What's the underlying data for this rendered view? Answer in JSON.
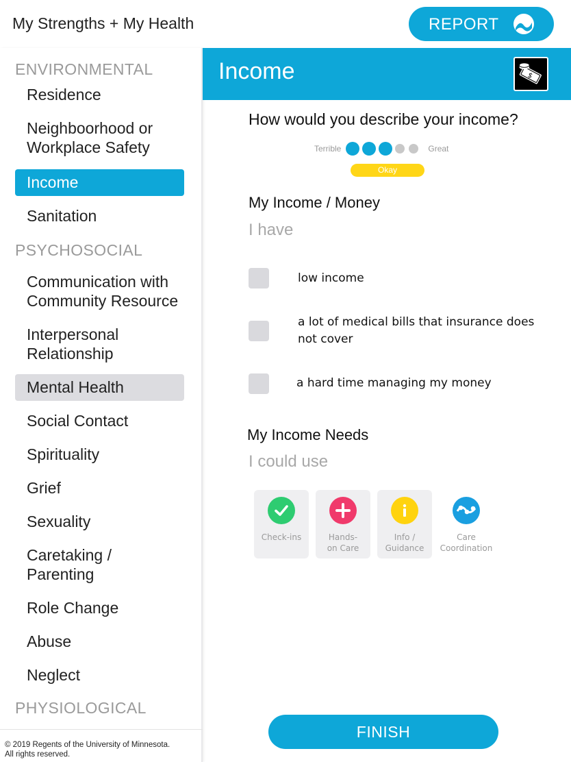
{
  "app": {
    "title": "My Strengths + My Health",
    "report_label": "REPORT"
  },
  "sidebar": {
    "sections": [
      {
        "label": "ENVIRONMENTAL"
      },
      {
        "label": "PSYCHOSOCIAL"
      },
      {
        "label": "PHYSIOLOGICAL"
      }
    ],
    "items": [
      {
        "label": "Residence"
      },
      {
        "label": "Neighboorhood or Workplace Safety"
      },
      {
        "label": "Income"
      },
      {
        "label": "Sanitation"
      },
      {
        "label": "Communication with Community Resource"
      },
      {
        "label": "Interpersonal Relationship"
      },
      {
        "label": "Mental Health"
      },
      {
        "label": "Social Contact"
      },
      {
        "label": "Spirituality"
      },
      {
        "label": "Grief"
      },
      {
        "label": "Sexuality"
      },
      {
        "label": "Caretaking / Parenting"
      },
      {
        "label": "Role Change"
      },
      {
        "label": "Abuse"
      },
      {
        "label": "Neglect"
      }
    ],
    "footer_line1": "© 2019 Regents of the University of Minnesota.",
    "footer_line2": "All rights reserved."
  },
  "main": {
    "title": "Income",
    "question": "How would you describe your income?",
    "scale": {
      "low_label": "Terrible",
      "high_label": "Great",
      "rating": 3,
      "max": 5,
      "rating_label": "Okay"
    },
    "strengths": {
      "title": "My Income / Money",
      "hint": "I have",
      "options": [
        {
          "label": "low income"
        },
        {
          "label": "a lot of medical bills that insurance does not cover"
        },
        {
          "label": "a hard time managing my money"
        }
      ]
    },
    "needs": {
      "title": "My Income Needs",
      "hint": "I could use",
      "options": [
        {
          "label": "Check-ins",
          "icon": "check-icon",
          "color": "#2ecc71"
        },
        {
          "label": "Hands-on Care",
          "icon": "plus-icon",
          "color": "#f03a6b"
        },
        {
          "label": "Info / Guidance",
          "icon": "info-icon",
          "color": "#ffd30f"
        },
        {
          "label": "Care Coordination",
          "icon": "coordination-icon",
          "color": "#1a9fe0"
        }
      ]
    },
    "finish_label": "FINISH"
  },
  "colors": {
    "accent": "#0ea7d8",
    "rating_pill": "#ffd617"
  }
}
